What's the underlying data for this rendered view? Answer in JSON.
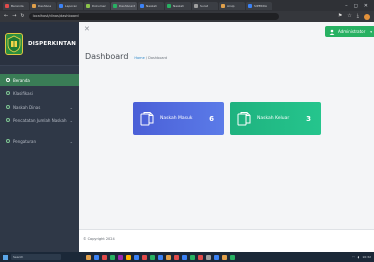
{
  "browser": {
    "tabs": [
      {
        "label": "Beranda",
        "color": "#e04b4b"
      },
      {
        "label": "Dashboa",
        "color": "#e0a04b"
      },
      {
        "label": "Laporan",
        "color": "#3b82f6"
      },
      {
        "label": "Dokumen",
        "color": "#8bc34a"
      },
      {
        "label": "Dashboard",
        "color": "#27b162",
        "active": true
      },
      {
        "label": "Naskah",
        "color": "#3b82f6"
      },
      {
        "label": "Naskah",
        "color": "#27b162"
      },
      {
        "label": "Surat",
        "color": "#9e9e9e"
      },
      {
        "label": "Arsip",
        "color": "#e0a04b"
      },
      {
        "label": "SIPERDA",
        "color": "#3b82f6"
      }
    ],
    "url": "localhost/dinas/dashboard",
    "window_controls": [
      "–",
      "◻",
      "✕"
    ]
  },
  "sidebar": {
    "brand": "DISPERKINTAN",
    "items": [
      {
        "label": "Beranda",
        "active": true,
        "has_chevron": false
      },
      {
        "label": "Klasifikasi",
        "active": false,
        "has_chevron": false
      },
      {
        "label": "Naskah Dinas",
        "active": false,
        "has_chevron": true
      },
      {
        "label": "Pencatatan Jumlah Naskah",
        "active": false,
        "has_chevron": true
      },
      {
        "label": "Pengaturan",
        "active": false,
        "has_chevron": true
      }
    ]
  },
  "header": {
    "close_symbol": "✕",
    "user_name": "Administrator",
    "title": "Dashboard",
    "breadcrumb_home": "Home",
    "breadcrumb_sep": " / ",
    "breadcrumb_current": "Dashboard"
  },
  "cards": [
    {
      "label": "Naskah Masuk",
      "value": "6",
      "icon": "document-copy-icon",
      "color": "#4a5fd7"
    },
    {
      "label": "Naskah Keluar",
      "value": "3",
      "icon": "document-copy-icon",
      "color": "#1fb27f"
    }
  ],
  "footer": {
    "text": "© Copyright 2024"
  },
  "taskbar": {
    "search_placeholder": "Search",
    "apps": [
      "#e0a04b",
      "#3b82f6",
      "#e04b4b",
      "#27b162",
      "#9c27b0",
      "#ffb300",
      "#3b82f6",
      "#e04b4b",
      "#27b162",
      "#3b82f6",
      "#e0a04b",
      "#e04b4b",
      "#3b82f6",
      "#27b162",
      "#e04b4b",
      "#9e9e9e",
      "#3b82f6",
      "#e0a04b",
      "#27b162"
    ],
    "clock": "10:32"
  }
}
